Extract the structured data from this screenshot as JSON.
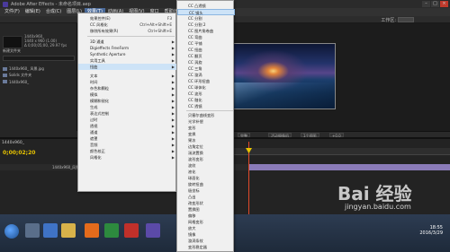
{
  "window": {
    "title": "Adobe After Effects - 未命名项目.aep",
    "controls": [
      "–",
      "□",
      "×"
    ]
  },
  "menubar": {
    "items": [
      "文件(F)",
      "编辑(E)",
      "合成(C)",
      "图层(L)",
      "效果(T)",
      "动画(A)",
      "视图(V)",
      "窗口",
      "帮助(H)"
    ],
    "active_index": 4
  },
  "toolbar": {
    "workspace_label": "工作区:"
  },
  "project": {
    "info": [
      "1440x960_",
      "1440 x 960 (1.00)",
      "Δ 0;00;05;00, 29.97 fps"
    ],
    "title_item": "新建文件夹",
    "rows": [
      "1440x960_ 风景.jpg",
      "Solids 文件夹",
      "1440x960_"
    ]
  },
  "viewer": {
    "zoom": "(47.2%)",
    "res": "完整",
    "camera": "活动摄像机",
    "views": "1个视图",
    "time": "+0.0"
  },
  "timeline": {
    "tab": "1440x960_",
    "timecode": "0;00;02;20",
    "layer_name": "1440x960_风景"
  },
  "effects_menu": {
    "items": [
      {
        "label": "效果控件(E)",
        "shortcut": "F3"
      },
      {
        "label": "CC 风格化",
        "shortcut": "Ctrl+Alt+Shift+E"
      },
      {
        "label": "移除所有效果(R)",
        "shortcut": "Ctrl+Shift+E"
      },
      {
        "label": "3D 通道",
        "arrow": true
      },
      {
        "label": "Digieffects FreeForm",
        "arrow": true
      },
      {
        "label": "Synthetic Aperture",
        "arrow": true
      },
      {
        "label": "实用工具",
        "arrow": true
      },
      {
        "label": "扭曲",
        "arrow": true
      },
      {
        "label": "文本",
        "arrow": true
      },
      {
        "label": "时间",
        "arrow": true
      },
      {
        "label": "杂色和颗粒",
        "arrow": true
      },
      {
        "label": "模拟",
        "arrow": true
      },
      {
        "label": "模糊和锐化",
        "arrow": true
      },
      {
        "label": "生成",
        "arrow": true
      },
      {
        "label": "表达式控制",
        "arrow": true
      },
      {
        "label": "过时",
        "arrow": true
      },
      {
        "label": "透视",
        "arrow": true
      },
      {
        "label": "通道",
        "arrow": true
      },
      {
        "label": "遮罩",
        "arrow": true
      },
      {
        "label": "音频",
        "arrow": true
      },
      {
        "label": "颜色校正",
        "arrow": true
      },
      {
        "label": "风格化",
        "arrow": true
      }
    ],
    "highlighted_index": 7
  },
  "submenu": {
    "items": [
      "CC 凸透镜",
      "CC 镜头",
      "CC 分割",
      "CC 分割 2",
      "CC 图片角卷曲",
      "CC 弯曲",
      "CC 平铺",
      "CC 扭曲",
      "CC 翻页",
      "CC 涡旋",
      "CC 三角",
      "CC 漩涡",
      "CC 环形扭曲",
      "CC 球体化",
      "CC 波形",
      "CC 融化",
      "CC 透镜",
      "贝塞尔曲线变形",
      "光学补偿",
      "变形",
      "变换",
      "果冻",
      "边角定位",
      "湍流置换",
      "波形变形",
      "波纹",
      "液化",
      "球面化",
      "旋转扭曲",
      "极坐标",
      "凸出",
      "改变形状",
      "置换图",
      "偏移",
      "网格变形",
      "放大",
      "镜像",
      "漩涡条纹",
      "变形稳定器"
    ],
    "highlighted_index": 1
  },
  "taskbar": {
    "clock_time": "18:55",
    "clock_date": "2016/3/29"
  },
  "watermark": {
    "logo": "Bai 经验",
    "url": "jingyan.baidu.com"
  },
  "colors": {
    "accent": "#4a6a9a",
    "menu_bg": "#f0f0f0",
    "menu_highlight": "#cde3f7",
    "timecode": "#e8c400",
    "playhead": "#e24a2a",
    "layer_bar": "#8a7bb8"
  }
}
